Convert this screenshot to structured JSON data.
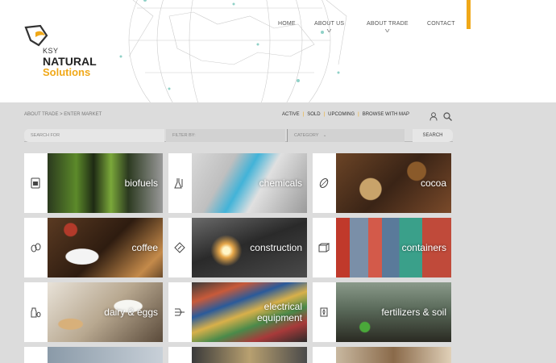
{
  "header": {
    "logo": {
      "ksy": "KSY",
      "natural": "NATURAL",
      "solutions": "Solutions"
    },
    "nav": [
      {
        "label": "HOME"
      },
      {
        "label": "ABOUT US"
      },
      {
        "label": "ABOUT TRADE"
      },
      {
        "label": "CONTACT"
      }
    ],
    "accent_color": "#f0a818"
  },
  "toolbar": {
    "breadcrumb": "ABOUT TRADE > ENTER MARKET",
    "filters": [
      "ACTIVE",
      "SOLD",
      "UPCOMING",
      "BROWSE WITH MAP"
    ],
    "separator": "|",
    "icons": [
      "user-icon",
      "search-icon"
    ]
  },
  "search": {
    "search_placeholder": "SEARCH FOR",
    "filter_placeholder": "FILTER BY:",
    "category_label": "CATEGORY",
    "button": "SEARCH"
  },
  "categories": [
    {
      "label": "biofuels",
      "icon": "biofuel-icon"
    },
    {
      "label": "chemicals",
      "icon": "chemicals-icon"
    },
    {
      "label": "cocoa",
      "icon": "cocoa-icon"
    },
    {
      "label": "coffee",
      "icon": "coffee-icon"
    },
    {
      "label": "construction",
      "icon": "construction-icon"
    },
    {
      "label": "containers",
      "icon": "containers-icon"
    },
    {
      "label": "dairy & eggs",
      "icon": "dairy-icon"
    },
    {
      "label": "electrical equipment",
      "icon": "electrical-icon"
    },
    {
      "label": "fertilizers & soil",
      "icon": "fertilizer-icon"
    }
  ]
}
